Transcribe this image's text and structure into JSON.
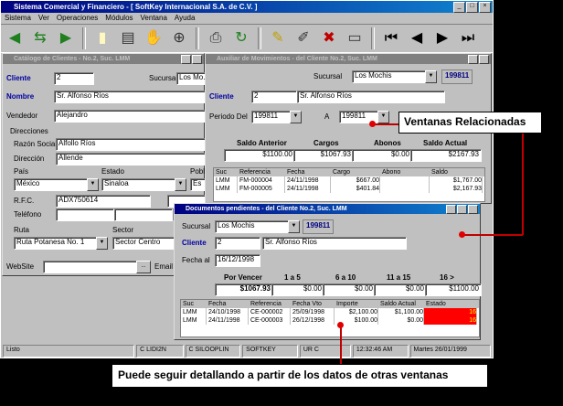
{
  "app": {
    "title": "Sistema Comercial y Financiero - [ SoftKey Internacional S.A. de C.V. ]",
    "menu": [
      "Sistema",
      "Ver",
      "Operaciones",
      "Módulos",
      "Ventana",
      "Ayuda"
    ]
  },
  "toolbar": {
    "icons": [
      "arrow-left-icon",
      "arrow-split-icon",
      "arrow-right-icon",
      "new-document-icon",
      "record-icon",
      "hand-icon",
      "binoculars-icon",
      "printer-icon",
      "refresh-icon",
      "pencil-icon",
      "brush-icon",
      "delete-icon",
      "comment-icon",
      "first-record-icon",
      "previous-record-icon",
      "next-record-icon",
      "last-record-icon"
    ]
  },
  "catalog": {
    "title": "Catálogo de Clientes - No.2, Suc. LMM",
    "cliente_label": "Cliente",
    "cliente_value": "2",
    "sucursal_label": "Sucursal",
    "sucursal_value": "Los Mo...",
    "nombre_label": "Nombre",
    "nombre_value": "Sr. Alfonso Ríos",
    "vendedor_label": "Vendedor",
    "vendedor_value": "Alejandro",
    "direcciones_label": "Direcciones",
    "razon_label": "Razón Social",
    "razon_value": "Alfollo Ríos",
    "direccion_label": "Dirección",
    "direccion_value": "Allende",
    "pais_label": "País",
    "pais_value": "México",
    "estado_label": "Estado",
    "estado_value": "Sinaloa",
    "pob_label": "Pobl",
    "pob_value": "Es",
    "rfc_label": "R.F.C.",
    "rfc_value": "ADX750614",
    "telefono_label": "Teléfono",
    "ruta_label": "Ruta",
    "ruta_value": "Ruta Potanesa No. 1",
    "sector_label": "Sector",
    "sector_value": "Sector Centro",
    "website_label": "WebSite",
    "email_label": "Email"
  },
  "movs": {
    "title": "Auxiliar de Movimientos - del Cliente No.2, Suc. LMM",
    "sucursal_label": "Sucursal",
    "sucursal_value": "Los Mochis",
    "period_badge": "199811",
    "cliente_label": "Cliente",
    "cliente_value": "2",
    "cliente_name": "Sr. Alfonso Ríos",
    "periodo_label": "Periodo Del",
    "periodo_from": "199811",
    "a_label": "A",
    "periodo_to": "199811",
    "summary_headers": [
      "Saldo Anterior",
      "Cargos",
      "Abonos",
      "Saldo Actual"
    ],
    "summary_values": [
      "$1100.00",
      "$1067.93",
      "$0.00",
      "$2167.93"
    ],
    "grid_headers": [
      "Suc",
      "Referencia",
      "Fecha",
      "Cargo",
      "Abono",
      "Saldo"
    ],
    "grid_rows": [
      [
        "LMM",
        "FM-000004",
        "24/11/1998",
        "$667.00",
        "",
        "$1,767.00"
      ],
      [
        "LMM",
        "FM-000005",
        "24/11/1998",
        "$401.84",
        "",
        "$2,167.93"
      ]
    ]
  },
  "pending": {
    "title": "Documentos pendientes - del Cliente No.2, Suc. LMM",
    "sucursal_label": "Sucursal",
    "sucursal_value": "Los Mochis",
    "period_badge": "199811",
    "cliente_label": "Cliente",
    "cliente_value": "2",
    "cliente_name": "Sr. Alfonso Ríos",
    "fecha_label": "Fecha al",
    "fecha_value": "16/12/1998",
    "aging_headers": [
      "Por Vencer",
      "1 a 5",
      "6 a 10",
      "11 a 15",
      "16 >"
    ],
    "aging_values": [
      "$1067.93",
      "$0.00",
      "$0.00",
      "$0.00",
      "$1100.00"
    ],
    "grid_headers": [
      "Suc",
      "Fecha",
      "Referencia",
      "Fecha Vto",
      "Importe",
      "Saldo Actual",
      "Estado"
    ],
    "grid_rows": [
      [
        "LMM",
        "24/10/1998",
        "CE-000002",
        "25/09/1998",
        "$2,100.00",
        "$1,100.00",
        "16"
      ],
      [
        "LMM",
        "24/11/1998",
        "CE-000003",
        "26/12/1998",
        "$100.00",
        "$0.00",
        "16"
      ]
    ]
  },
  "status": [
    "Listo",
    "C LIDI2N",
    "C SILOOPLIN",
    "SOFTKEY",
    "UR C",
    "12:32:46 AM",
    "Martes 26/01/1999"
  ],
  "callouts": {
    "related": "Ventanas Relacionadas",
    "detail": "Puede seguir detallando a partir de los datos de otras ventanas"
  },
  "colors": {
    "accent": "#000080",
    "alert": "#ff0000",
    "callout_line": "#c00000"
  }
}
